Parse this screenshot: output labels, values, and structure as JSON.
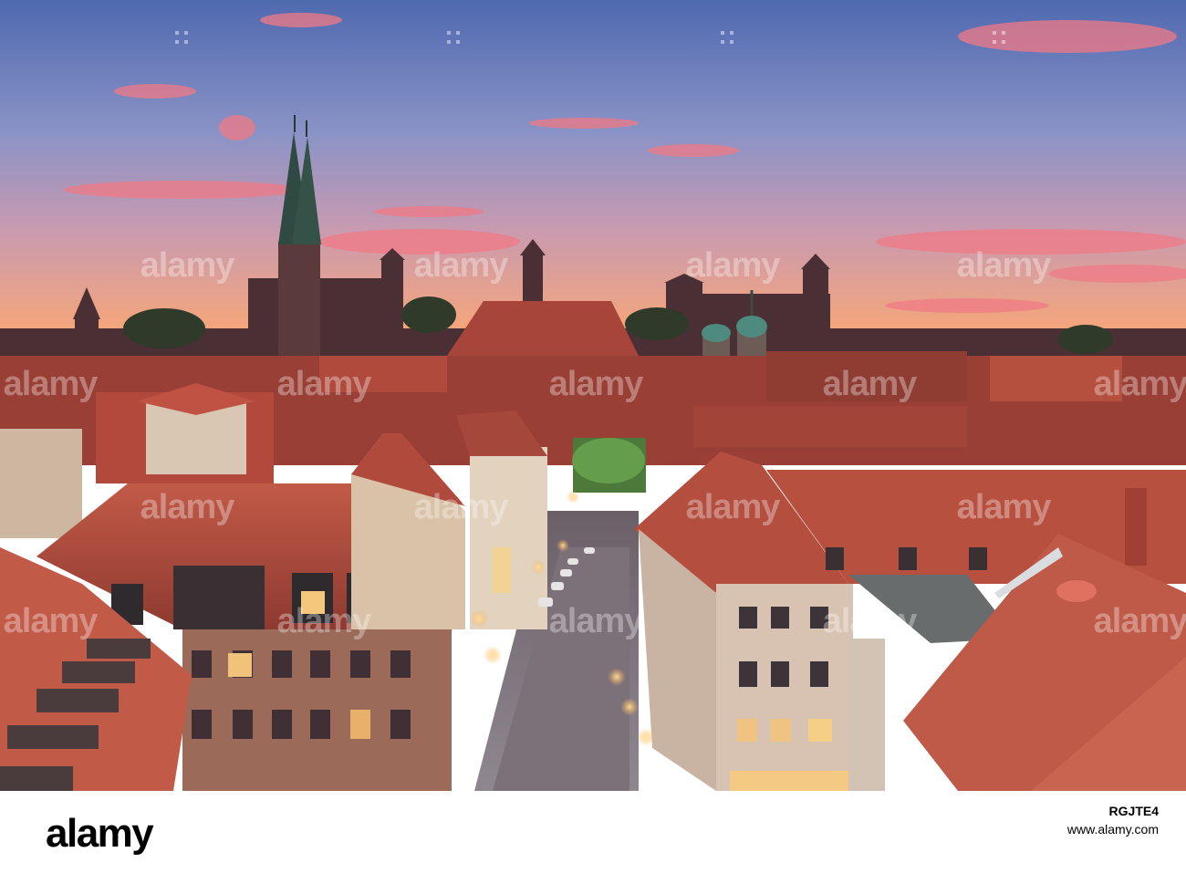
{
  "image": {
    "description_kind": "photo",
    "watermark_text": "alamy",
    "footer": {
      "logo": "alamy",
      "image_id": "RGJTE4",
      "site": "www.alamy.com"
    },
    "colors": {
      "sky_top": "#5b73b6",
      "sky_mid": "#8c97c8",
      "sky_horizon": "#f4a07a",
      "roof_red": "#b24a3c",
      "silhouette": "#3a2a2e",
      "lamp_glow": "#ffd27a"
    }
  }
}
